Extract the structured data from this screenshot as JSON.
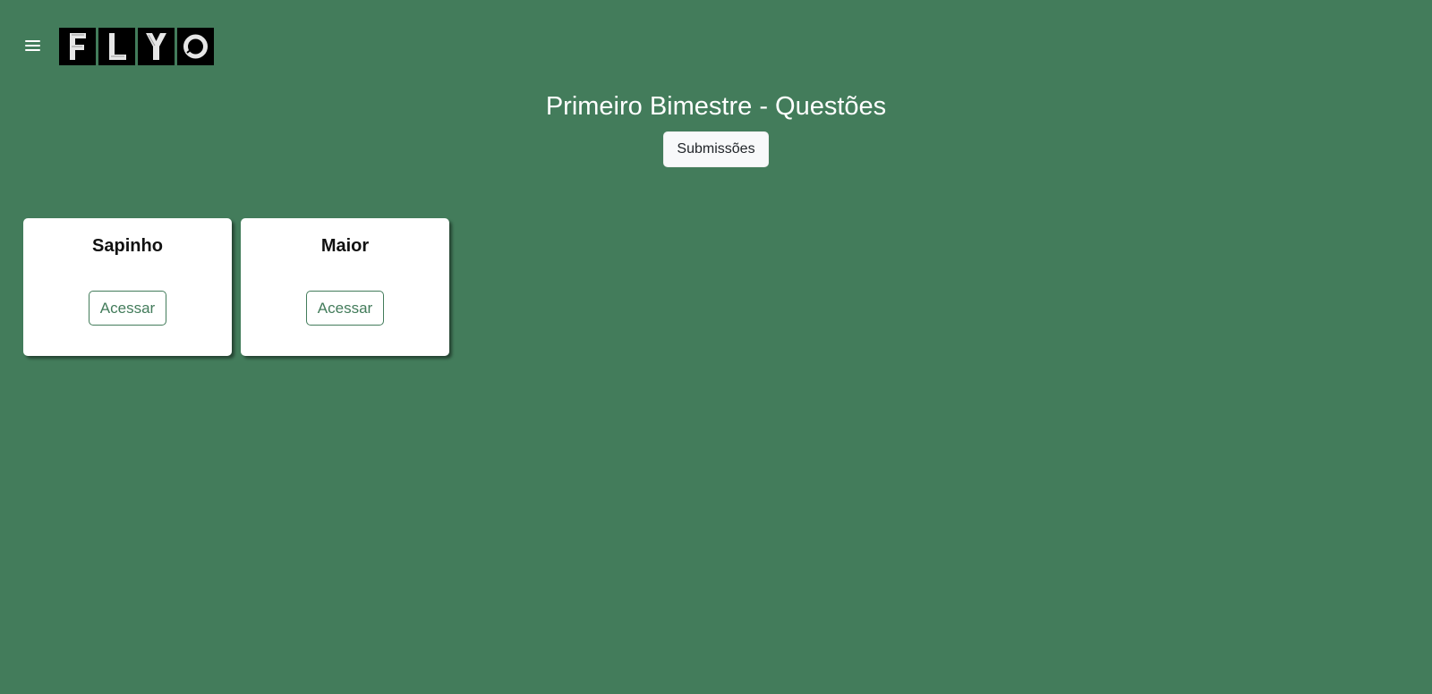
{
  "header": {
    "menu_icon": "hamburger-menu-icon",
    "logo_letters": [
      "F",
      "L",
      "Y",
      "O"
    ]
  },
  "page": {
    "title": "Primeiro Bimestre - Questões",
    "submissions_label": "Submissões"
  },
  "cards": [
    {
      "title": "Sapinho",
      "button_label": "Acessar"
    },
    {
      "title": "Maior",
      "button_label": "Acessar"
    }
  ],
  "colors": {
    "background": "#437c5b",
    "card": "#ffffff",
    "accent": "#437c5b",
    "logo_tile": "#000000"
  }
}
